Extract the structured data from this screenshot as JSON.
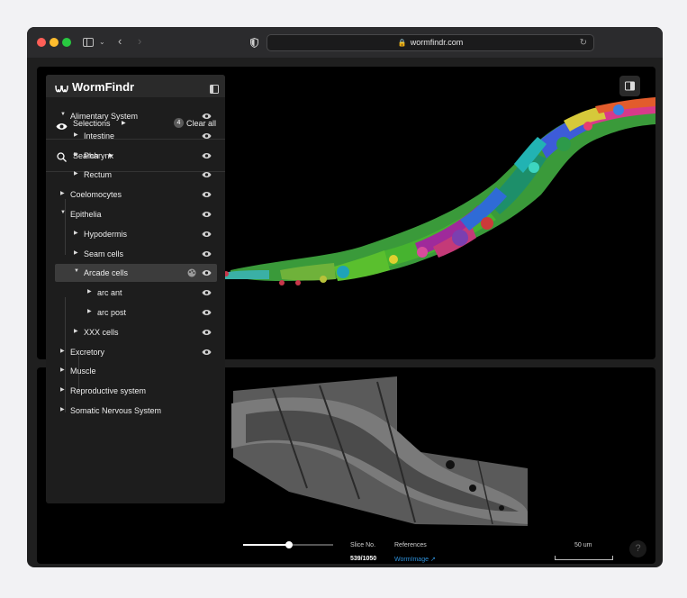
{
  "browser": {
    "url": "wormfindr.com"
  },
  "app": {
    "name": "WormFindr"
  },
  "sidebar": {
    "selections_label": "Selections",
    "selections_count": "4",
    "clear_all_label": "Clear all",
    "search_label": "Search",
    "tree": [
      {
        "label": "Alimentary System",
        "level": 0,
        "expanded": true,
        "visible": true
      },
      {
        "label": "Intestine",
        "level": 1,
        "expanded": false,
        "visible": true
      },
      {
        "label": "Pharynx",
        "level": 1,
        "expanded": false,
        "visible": true
      },
      {
        "label": "Rectum",
        "level": 1,
        "expanded": false,
        "visible": true
      },
      {
        "label": "Coelomocytes",
        "level": 0,
        "expanded": false,
        "visible": true
      },
      {
        "label": "Epithelia",
        "level": 0,
        "expanded": true,
        "visible": true
      },
      {
        "label": "Hypodermis",
        "level": 1,
        "expanded": false,
        "visible": true
      },
      {
        "label": "Seam cells",
        "level": 1,
        "expanded": false,
        "visible": true
      },
      {
        "label": "Arcade cells",
        "level": 1,
        "expanded": true,
        "visible": true,
        "selected": true
      },
      {
        "label": "arc ant",
        "level": 2,
        "expanded": false,
        "visible": true
      },
      {
        "label": "arc post",
        "level": 2,
        "expanded": false,
        "visible": true
      },
      {
        "label": "XXX cells",
        "level": 1,
        "expanded": false,
        "visible": true
      },
      {
        "label": "Excretory",
        "level": 0,
        "expanded": false,
        "visible": true
      },
      {
        "label": "Muscle",
        "level": 0,
        "expanded": false,
        "visible": false
      },
      {
        "label": "Reproductive system",
        "level": 0,
        "expanded": false,
        "visible": false
      },
      {
        "label": "Somatic Nervous System",
        "level": 0,
        "expanded": false,
        "visible": false
      }
    ]
  },
  "viewer": {
    "slice_label": "Slice No.",
    "slice_value": "539/1050",
    "slice_current": 539,
    "slice_total": 1050,
    "references_label": "References",
    "reference_link": "WormImage",
    "scale_label": "50 um",
    "help_label": "?"
  },
  "colors": {
    "link": "#2e90d9",
    "highlight_row": "#3c3c3c"
  }
}
